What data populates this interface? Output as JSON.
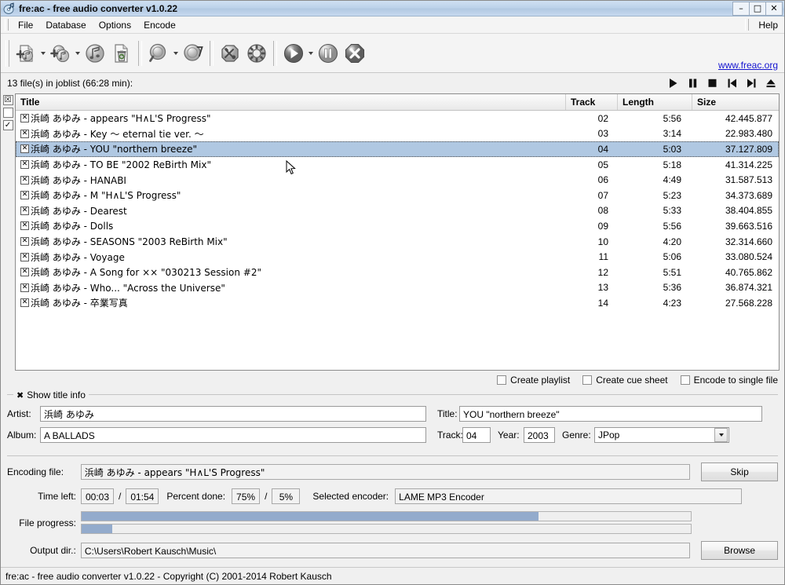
{
  "window": {
    "title": "fre:ac - free audio converter v1.0.22",
    "app_icon": "cd-music-icon",
    "minimize": "–",
    "maximize": "□",
    "close": "✕"
  },
  "menubar": {
    "items": [
      {
        "label": "File",
        "name": "menu-file"
      },
      {
        "label": "Database",
        "name": "menu-database"
      },
      {
        "label": "Options",
        "name": "menu-options"
      },
      {
        "label": "Encode",
        "name": "menu-encode"
      }
    ],
    "help": "Help"
  },
  "toolbar": {
    "link": "www.freac.org",
    "buttons": [
      {
        "name": "add-audio-file-button",
        "icon": "add-file-icon",
        "dropdown": true
      },
      {
        "name": "add-audio-cd-button",
        "icon": "add-cd-icon",
        "dropdown": true
      },
      {
        "name": "remove-track-button",
        "icon": "remove-track-icon",
        "dropdown": false
      },
      {
        "name": "clear-joblist-button",
        "icon": "clear-joblist-icon",
        "dropdown": false
      },
      {
        "name": "load-joblist-button",
        "icon": "magnifier-icon",
        "dropdown": true
      },
      {
        "name": "save-joblist-button",
        "icon": "cd-query-icon",
        "dropdown": false
      },
      {
        "name": "general-settings-button",
        "icon": "tools-icon",
        "dropdown": false
      },
      {
        "name": "configure-encoder-button",
        "icon": "gear-icon",
        "dropdown": false
      },
      {
        "name": "start-encoding-button",
        "icon": "play-icon",
        "dropdown": true
      },
      {
        "name": "pause-encoding-button",
        "icon": "pause-icon",
        "dropdown": false
      },
      {
        "name": "stop-encoding-button",
        "icon": "stop-cross-icon",
        "dropdown": false
      }
    ]
  },
  "joblist": {
    "summary": "13 file(s) in joblist (66:28 min):",
    "playback_buttons": [
      {
        "name": "playback-play-button",
        "icon": "play-icon"
      },
      {
        "name": "playback-pause-button",
        "icon": "pause-icon"
      },
      {
        "name": "playback-stop-button",
        "icon": "stop-icon"
      },
      {
        "name": "playback-previous-button",
        "icon": "previous-icon"
      },
      {
        "name": "playback-next-button",
        "icon": "next-icon"
      },
      {
        "name": "playback-eject-button",
        "icon": "eject-icon"
      }
    ],
    "gutter": [
      {
        "name": "select-all-toggle",
        "glyph": "☒"
      },
      {
        "name": "select-none-toggle",
        "glyph": ""
      },
      {
        "name": "toggle-selection-button",
        "glyph": "✓"
      }
    ],
    "columns": {
      "title": "Title",
      "track": "Track",
      "length": "Length",
      "size": "Size"
    },
    "selection_color": "#b0c8e2",
    "rows": [
      {
        "checked": "☒",
        "title": "浜崎 あゆみ - appears \"H∧L'S Progress\"",
        "track": "02",
        "length": "5:56",
        "size": "42.445.877",
        "selected": false
      },
      {
        "checked": "☒",
        "title": "浜崎 あゆみ - Key 〜 eternal tie ver. 〜",
        "track": "03",
        "length": "3:14",
        "size": "22.983.480",
        "selected": false
      },
      {
        "checked": "☒",
        "title": "浜崎 あゆみ - YOU \"northern breeze\"",
        "track": "04",
        "length": "5:03",
        "size": "37.127.809",
        "selected": true
      },
      {
        "checked": "☒",
        "title": "浜崎 あゆみ - TO BE \"2002 ReBirth Mix\"",
        "track": "05",
        "length": "5:18",
        "size": "41.314.225",
        "selected": false
      },
      {
        "checked": "☒",
        "title": "浜崎 あゆみ - HANABI",
        "track": "06",
        "length": "4:49",
        "size": "31.587.513",
        "selected": false
      },
      {
        "checked": "☒",
        "title": "浜崎 あゆみ - M \"H∧L'S Progress\"",
        "track": "07",
        "length": "5:23",
        "size": "34.373.689",
        "selected": false
      },
      {
        "checked": "☒",
        "title": "浜崎 あゆみ - Dearest",
        "track": "08",
        "length": "5:33",
        "size": "38.404.855",
        "selected": false
      },
      {
        "checked": "☒",
        "title": "浜崎 あゆみ - Dolls",
        "track": "09",
        "length": "5:56",
        "size": "39.663.516",
        "selected": false
      },
      {
        "checked": "☒",
        "title": "浜崎 あゆみ - SEASONS \"2003 ReBirth Mix\"",
        "track": "10",
        "length": "4:20",
        "size": "32.314.660",
        "selected": false
      },
      {
        "checked": "☒",
        "title": "浜崎 あゆみ - Voyage",
        "track": "11",
        "length": "5:06",
        "size": "33.080.524",
        "selected": false
      },
      {
        "checked": "☒",
        "title": "浜崎 あゆみ - A Song for ×× \"030213 Session #2\"",
        "track": "12",
        "length": "5:51",
        "size": "40.765.862",
        "selected": false
      },
      {
        "checked": "☒",
        "title": "浜崎 あゆみ - Who... \"Across the Universe\"",
        "track": "13",
        "length": "5:36",
        "size": "36.874.321",
        "selected": false
      },
      {
        "checked": "☒",
        "title": "浜崎 あゆみ - 卒業写真",
        "track": "14",
        "length": "4:23",
        "size": "27.568.228",
        "selected": false
      }
    ]
  },
  "options": [
    {
      "name": "create-playlist-checkbox",
      "label": "Create playlist",
      "checked": false
    },
    {
      "name": "create-cue-sheet-checkbox",
      "label": "Create cue sheet",
      "checked": false
    },
    {
      "name": "encode-to-single-file-checkbox",
      "label": "Encode to single file",
      "checked": false
    }
  ],
  "title_info": {
    "group_label": "Show title info",
    "group_checked": "✖",
    "artist_label": "Artist:",
    "artist_value": "浜崎 あゆみ",
    "title_label": "Title:",
    "title_value": "YOU \"northern breeze\"",
    "album_label": "Album:",
    "album_value": "A BALLADS",
    "track_label": "Track:",
    "track_value": "04",
    "year_label": "Year:",
    "year_value": "2003",
    "genre_label": "Genre:",
    "genre_value": "JPop"
  },
  "encoding": {
    "file_label": "Encoding file:",
    "file_value": "浜崎 あゆみ - appears \"H∧L'S Progress\"",
    "skip_button": "Skip",
    "time_left_label": "Time left:",
    "time_left_current": "00:03",
    "time_sep": "/",
    "time_left_total": "01:54",
    "percent_label": "Percent done:",
    "percent_file": "75%",
    "percent_sep": "/",
    "percent_total": "5%",
    "encoder_label": "Selected encoder:",
    "encoder_value": "LAME MP3 Encoder",
    "progress_label": "File progress:",
    "file_progress_pct": 75,
    "total_progress_pct": 5,
    "progress_color": "#93abcc",
    "output_label": "Output dir.:",
    "output_value": "C:\\Users\\Robert Kausch\\Music\\",
    "browse_button": "Browse"
  },
  "statusbar": {
    "text": "fre:ac - free audio converter v1.0.22 - Copyright (C) 2001-2014 Robert Kausch"
  }
}
